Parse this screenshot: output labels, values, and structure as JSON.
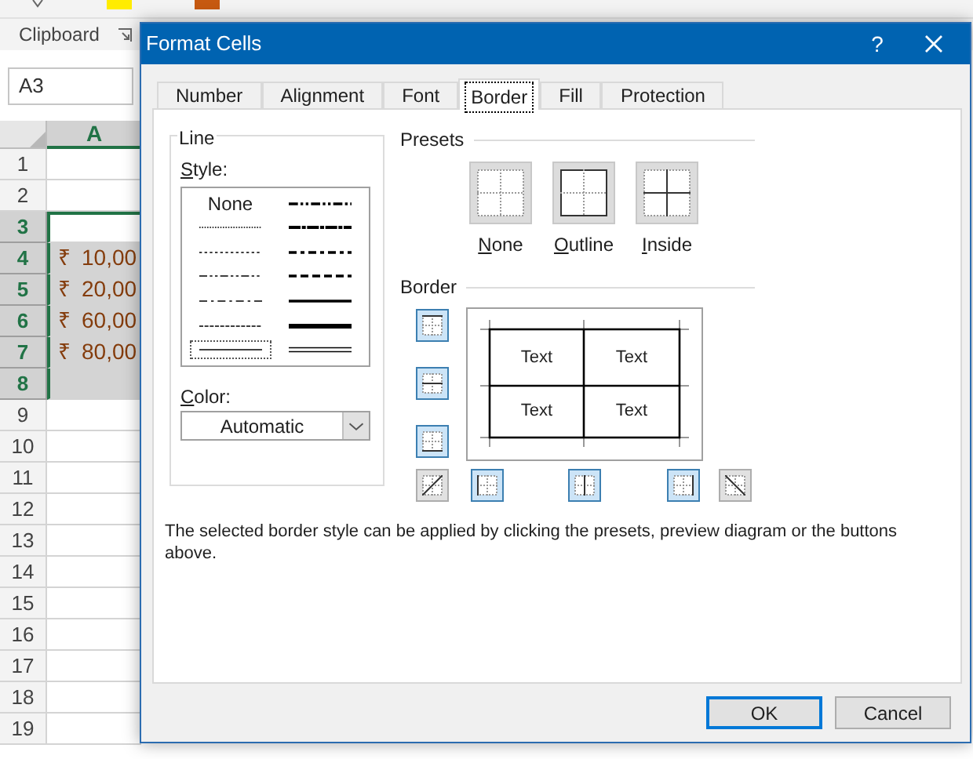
{
  "ribbon": {
    "group_label": "Clipboard"
  },
  "name_box": {
    "value": "A3"
  },
  "sheet": {
    "column_header": "A",
    "rows": [
      {
        "number": "1",
        "selected": false,
        "active": false
      },
      {
        "number": "2",
        "selected": false,
        "active": false
      },
      {
        "number": "3",
        "selected": true,
        "active": true
      },
      {
        "number": "4",
        "selected": true,
        "active": false,
        "currency": "₹",
        "amount": "10,00"
      },
      {
        "number": "5",
        "selected": true,
        "active": false,
        "currency": "₹",
        "amount": "20,00"
      },
      {
        "number": "6",
        "selected": true,
        "active": false,
        "currency": "₹",
        "amount": "60,00"
      },
      {
        "number": "7",
        "selected": true,
        "active": false,
        "currency": "₹",
        "amount": "80,00"
      },
      {
        "number": "8",
        "selected": true,
        "active": false
      },
      {
        "number": "9",
        "selected": false,
        "active": false
      },
      {
        "number": "10",
        "selected": false,
        "active": false
      },
      {
        "number": "11",
        "selected": false,
        "active": false
      },
      {
        "number": "12",
        "selected": false,
        "active": false
      },
      {
        "number": "13",
        "selected": false,
        "active": false
      },
      {
        "number": "14",
        "selected": false,
        "active": false
      },
      {
        "number": "15",
        "selected": false,
        "active": false
      },
      {
        "number": "16",
        "selected": false,
        "active": false
      },
      {
        "number": "17",
        "selected": false,
        "active": false
      },
      {
        "number": "18",
        "selected": false,
        "active": false
      },
      {
        "number": "19",
        "selected": false,
        "active": false
      }
    ]
  },
  "dialog": {
    "title": "Format Cells",
    "help": "?",
    "tabs": [
      {
        "label": "Number",
        "selected": false
      },
      {
        "label": "Alignment",
        "selected": false
      },
      {
        "label": "Font",
        "selected": false
      },
      {
        "label": "Border",
        "selected": true
      },
      {
        "label": "Fill",
        "selected": false
      },
      {
        "label": "Protection",
        "selected": false
      }
    ],
    "line": {
      "title": "Line",
      "style_label": "Style:",
      "styles": [
        {
          "kind": "none",
          "label": "None",
          "selected": false
        },
        {
          "kind": "hair",
          "selected": false
        },
        {
          "kind": "dotted",
          "selected": false
        },
        {
          "kind": "dash_dot_dot",
          "selected": false
        },
        {
          "kind": "dash_dot",
          "selected": false
        },
        {
          "kind": "dashed",
          "selected": false
        },
        {
          "kind": "thin",
          "selected": true
        },
        {
          "kind": "medium_dash_dot_dot",
          "selected": false
        },
        {
          "kind": "slanted_dash_dot",
          "selected": false
        },
        {
          "kind": "medium_dash_dot",
          "selected": false
        },
        {
          "kind": "medium_dashed",
          "selected": false
        },
        {
          "kind": "medium",
          "selected": false
        },
        {
          "kind": "thick",
          "selected": false
        },
        {
          "kind": "double",
          "selected": false
        }
      ],
      "color_label": "Color:",
      "color_value": "Automatic"
    },
    "presets": {
      "title": "Presets",
      "items": [
        {
          "kind": "none",
          "label": "None"
        },
        {
          "kind": "outline",
          "label": "Outline"
        },
        {
          "kind": "inside",
          "label": "Inside"
        }
      ]
    },
    "border": {
      "title": "Border",
      "buttons": [
        {
          "kind": "top",
          "on": true
        },
        {
          "kind": "horizontal",
          "on": true
        },
        {
          "kind": "bottom",
          "on": true
        },
        {
          "kind": "diagonal_up",
          "on": false
        },
        {
          "kind": "left",
          "on": true
        },
        {
          "kind": "vertical",
          "on": true
        },
        {
          "kind": "right",
          "on": true
        },
        {
          "kind": "diagonal_down",
          "on": false
        }
      ],
      "preview_texts": [
        "Text",
        "Text",
        "Text",
        "Text"
      ]
    },
    "description": "The selected border style can be applied by clicking the presets, preview diagram or the buttons above.",
    "buttons": [
      {
        "label": "OK",
        "default": true
      },
      {
        "label": "Cancel",
        "default": false
      }
    ]
  }
}
